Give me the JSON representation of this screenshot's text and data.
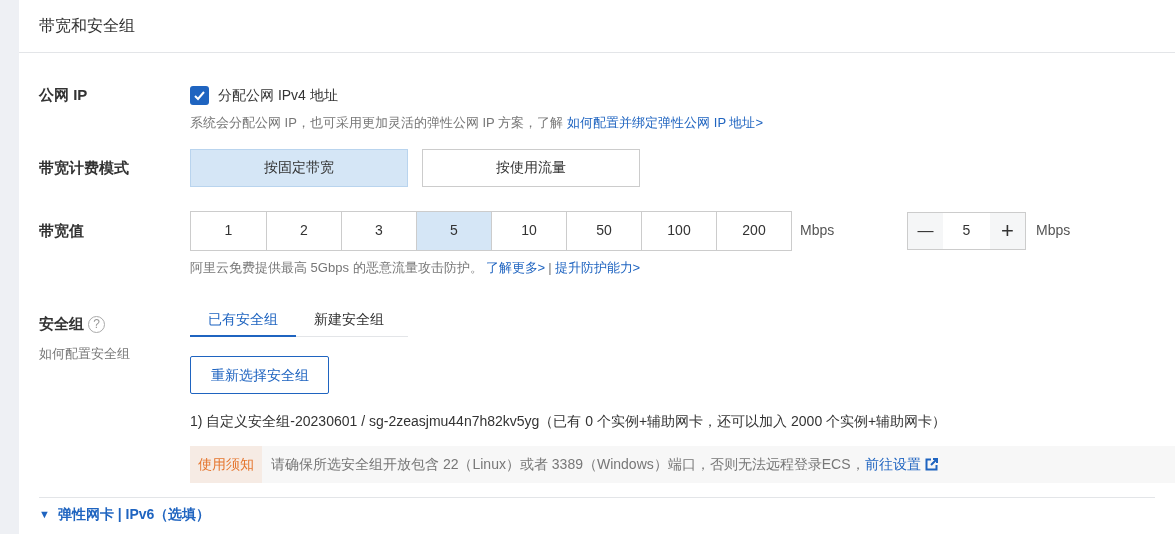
{
  "section_title": "带宽和安全组",
  "public_ip": {
    "label": "公网 IP",
    "checkbox": {
      "label": "分配公网 IPv4 地址",
      "checked": true
    },
    "hint": "系统会分配公网 IP，也可采用更加灵活的弹性公网 IP 方案，了解",
    "hint_link": "如何配置并绑定弹性公网 IP 地址>"
  },
  "billing_mode": {
    "label": "带宽计费模式",
    "options": [
      {
        "label": "按固定带宽",
        "selected": true
      },
      {
        "label": "按使用流量",
        "selected": false
      }
    ]
  },
  "bandwidth": {
    "label": "带宽值",
    "options": [
      {
        "label": "1",
        "selected": false
      },
      {
        "label": "2",
        "selected": false
      },
      {
        "label": "3",
        "selected": false
      },
      {
        "label": "5",
        "selected": true
      },
      {
        "label": "10",
        "selected": false
      },
      {
        "label": "50",
        "selected": false
      },
      {
        "label": "100",
        "selected": false
      },
      {
        "label": "200",
        "selected": false
      }
    ],
    "unit": "Mbps",
    "stepper": {
      "minus": "—",
      "value": "5",
      "plus": "+"
    },
    "stepper_unit": "Mbps",
    "hint": "阿里云免费提供最高 5Gbps 的恶意流量攻击防护。",
    "links": [
      "了解更多>",
      "提升防护能力>"
    ],
    "separator": "|"
  },
  "security_group": {
    "label": "安全组",
    "help_icon": "?",
    "sublabel": "如何配置安全组",
    "tabs": [
      {
        "label": "已有安全组",
        "selected": true
      },
      {
        "label": "新建安全组",
        "selected": false
      }
    ],
    "reselect_button": "重新选择安全组",
    "selected_group": "1) 自定义安全组-20230601 / sg-2zeasjmu44n7h82kv5yg（已有 0 个实例+辅助网卡，还可以加入 2000 个实例+辅助网卡）",
    "notice": {
      "tag": "使用须知",
      "text": "请确保所选安全组开放包含 22（Linux）或者 3389（Windows）端口，否则无法远程登录ECS，",
      "link": "前往设置"
    }
  },
  "next_section": {
    "arrow": "▼",
    "title": "弹性网卡 | IPv6（选填）"
  }
}
